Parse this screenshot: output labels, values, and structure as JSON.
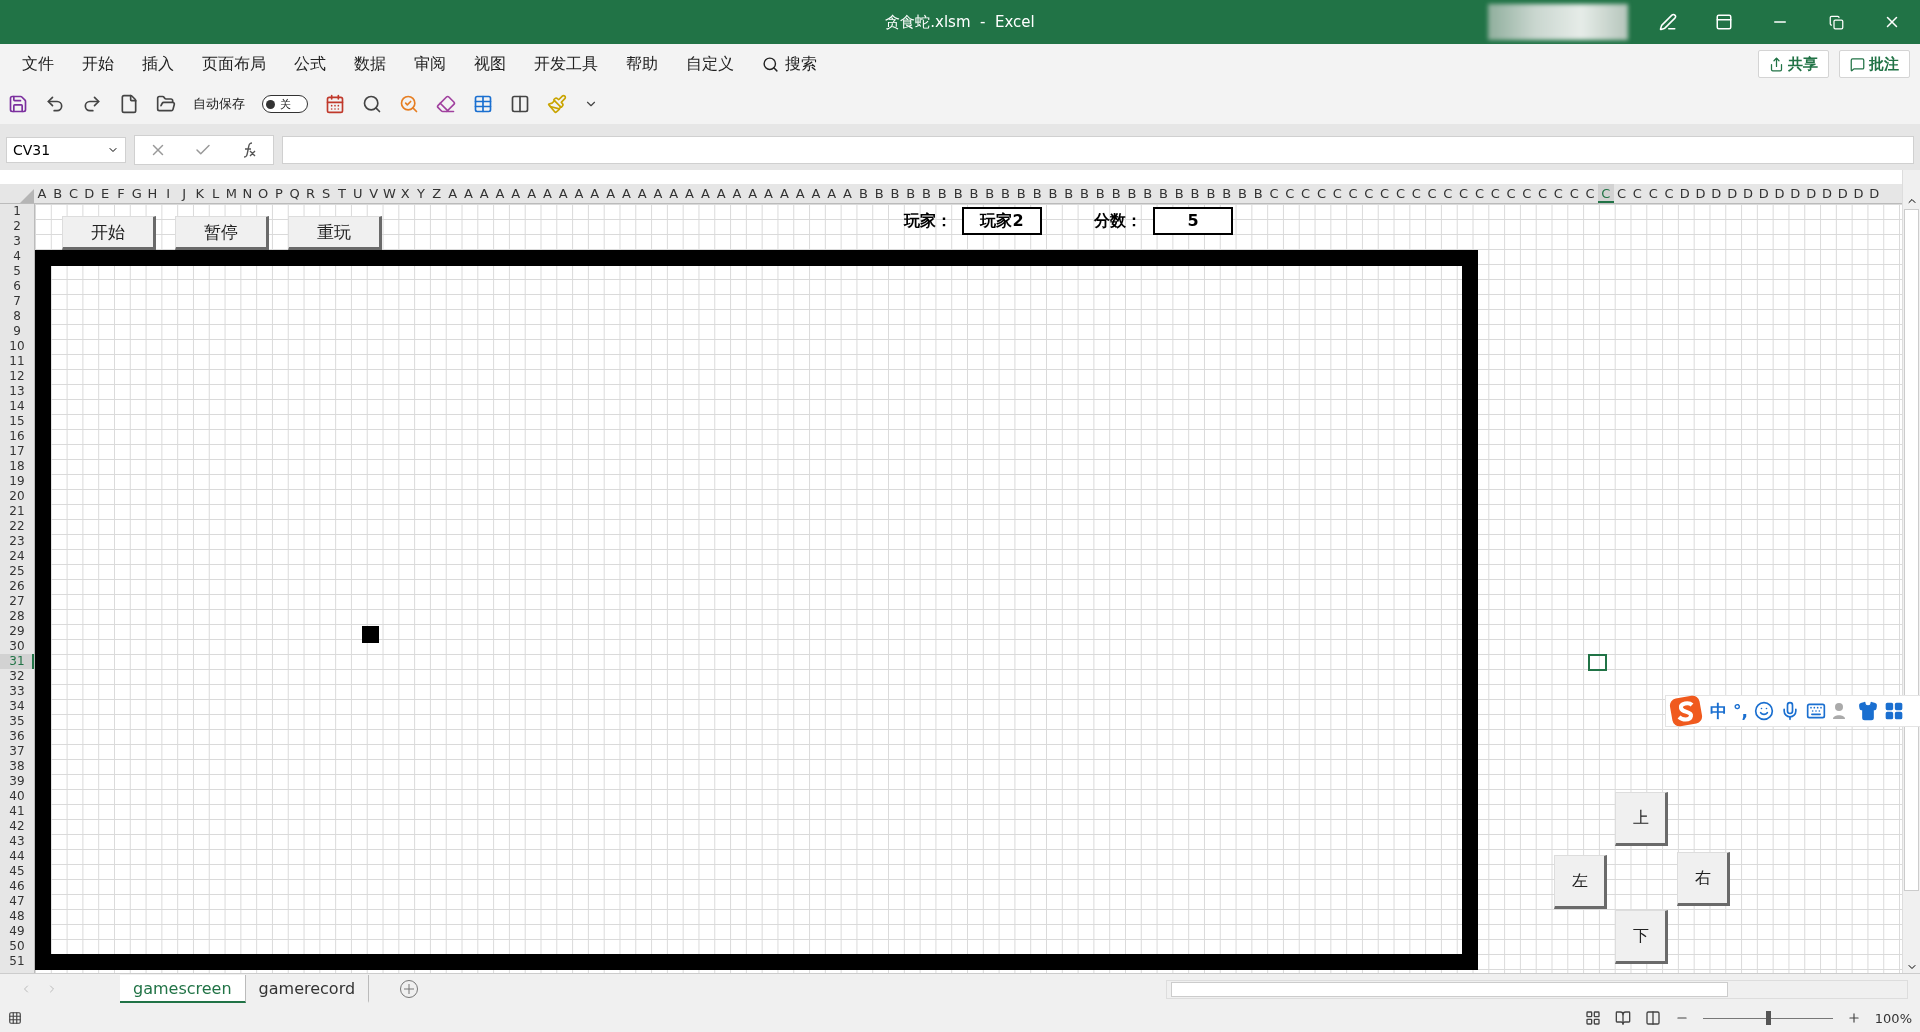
{
  "window": {
    "title": "贪食蛇.xlsm  -  Excel"
  },
  "menu": [
    "文件",
    "开始",
    "插入",
    "页面布局",
    "公式",
    "数据",
    "审阅",
    "视图",
    "开发工具",
    "帮助",
    "自定义"
  ],
  "menu_search": {
    "label": "搜索"
  },
  "header_buttons": [
    {
      "kind": "share",
      "label": "共享"
    },
    {
      "kind": "comment",
      "label": "批注"
    }
  ],
  "quick_access": {
    "autosave_label": "自动保存",
    "autosave": {
      "on": false,
      "label": "关"
    }
  },
  "formula_bar": {
    "name_box": "CV31"
  },
  "column_headers": [
    {
      "label": "A",
      "selected": false
    },
    {
      "label": "B",
      "selected": false
    },
    {
      "label": "C",
      "selected": false
    },
    {
      "label": "D",
      "selected": false
    },
    {
      "label": "E",
      "selected": false
    },
    {
      "label": "F",
      "selected": false
    },
    {
      "label": "G",
      "selected": false
    },
    {
      "label": "H",
      "selected": false
    },
    {
      "label": "I",
      "selected": false
    },
    {
      "label": "J",
      "selected": false
    },
    {
      "label": "K",
      "selected": false
    },
    {
      "label": "L",
      "selected": false
    },
    {
      "label": "M",
      "selected": false
    },
    {
      "label": "N",
      "selected": false
    },
    {
      "label": "O",
      "selected": false
    },
    {
      "label": "P",
      "selected": false
    },
    {
      "label": "Q",
      "selected": false
    },
    {
      "label": "R",
      "selected": false
    },
    {
      "label": "S",
      "selected": false
    },
    {
      "label": "T",
      "selected": false
    },
    {
      "label": "U",
      "selected": false
    },
    {
      "label": "V",
      "selected": false
    },
    {
      "label": "W",
      "selected": false
    },
    {
      "label": "X",
      "selected": false
    },
    {
      "label": "Y",
      "selected": false
    },
    {
      "label": "Z",
      "selected": false
    },
    {
      "label": "A",
      "selected": false
    },
    {
      "label": "A",
      "selected": false
    },
    {
      "label": "A",
      "selected": false
    },
    {
      "label": "A",
      "selected": false
    },
    {
      "label": "A",
      "selected": false
    },
    {
      "label": "A",
      "selected": false
    },
    {
      "label": "A",
      "selected": false
    },
    {
      "label": "A",
      "selected": false
    },
    {
      "label": "A",
      "selected": false
    },
    {
      "label": "A",
      "selected": false
    },
    {
      "label": "A",
      "selected": false
    },
    {
      "label": "A",
      "selected": false
    },
    {
      "label": "A",
      "selected": false
    },
    {
      "label": "A",
      "selected": false
    },
    {
      "label": "A",
      "selected": false
    },
    {
      "label": "A",
      "selected": false
    },
    {
      "label": "A",
      "selected": false
    },
    {
      "label": "A",
      "selected": false
    },
    {
      "label": "A",
      "selected": false
    },
    {
      "label": "A",
      "selected": false
    },
    {
      "label": "A",
      "selected": false
    },
    {
      "label": "A",
      "selected": false
    },
    {
      "label": "A",
      "selected": false
    },
    {
      "label": "A",
      "selected": false
    },
    {
      "label": "A",
      "selected": false
    },
    {
      "label": "A",
      "selected": false
    },
    {
      "label": "B",
      "selected": false
    },
    {
      "label": "B",
      "selected": false
    },
    {
      "label": "B",
      "selected": false
    },
    {
      "label": "B",
      "selected": false
    },
    {
      "label": "B",
      "selected": false
    },
    {
      "label": "B",
      "selected": false
    },
    {
      "label": "B",
      "selected": false
    },
    {
      "label": "B",
      "selected": false
    },
    {
      "label": "B",
      "selected": false
    },
    {
      "label": "B",
      "selected": false
    },
    {
      "label": "B",
      "selected": false
    },
    {
      "label": "B",
      "selected": false
    },
    {
      "label": "B",
      "selected": false
    },
    {
      "label": "B",
      "selected": false
    },
    {
      "label": "B",
      "selected": false
    },
    {
      "label": "B",
      "selected": false
    },
    {
      "label": "B",
      "selected": false
    },
    {
      "label": "B",
      "selected": false
    },
    {
      "label": "B",
      "selected": false
    },
    {
      "label": "B",
      "selected": false
    },
    {
      "label": "B",
      "selected": false
    },
    {
      "label": "B",
      "selected": false
    },
    {
      "label": "B",
      "selected": false
    },
    {
      "label": "B",
      "selected": false
    },
    {
      "label": "B",
      "selected": false
    },
    {
      "label": "B",
      "selected": false
    },
    {
      "label": "C",
      "selected": false
    },
    {
      "label": "C",
      "selected": false
    },
    {
      "label": "C",
      "selected": false
    },
    {
      "label": "C",
      "selected": false
    },
    {
      "label": "C",
      "selected": false
    },
    {
      "label": "C",
      "selected": false
    },
    {
      "label": "C",
      "selected": false
    },
    {
      "label": "C",
      "selected": false
    },
    {
      "label": "C",
      "selected": false
    },
    {
      "label": "C",
      "selected": false
    },
    {
      "label": "C",
      "selected": false
    },
    {
      "label": "C",
      "selected": false
    },
    {
      "label": "C",
      "selected": false
    },
    {
      "label": "C",
      "selected": false
    },
    {
      "label": "C",
      "selected": false
    },
    {
      "label": "C",
      "selected": false
    },
    {
      "label": "C",
      "selected": false
    },
    {
      "label": "C",
      "selected": false
    },
    {
      "label": "C",
      "selected": false
    },
    {
      "label": "C",
      "selected": false
    },
    {
      "label": "C",
      "selected": false
    },
    {
      "label": "C",
      "selected": true
    },
    {
      "label": "C",
      "selected": false
    },
    {
      "label": "C",
      "selected": false
    },
    {
      "label": "C",
      "selected": false
    },
    {
      "label": "C",
      "selected": false
    },
    {
      "label": "D",
      "selected": false
    },
    {
      "label": "D",
      "selected": false
    },
    {
      "label": "D",
      "selected": false
    },
    {
      "label": "D",
      "selected": false
    },
    {
      "label": "D",
      "selected": false
    },
    {
      "label": "D",
      "selected": false
    },
    {
      "label": "D",
      "selected": false
    },
    {
      "label": "D",
      "selected": false
    },
    {
      "label": "D",
      "selected": false
    },
    {
      "label": "D",
      "selected": false
    },
    {
      "label": "D",
      "selected": false
    },
    {
      "label": "D",
      "selected": false
    },
    {
      "label": "D",
      "selected": false
    }
  ],
  "row_headers": [
    {
      "label": "1",
      "selected": false
    },
    {
      "label": "2",
      "selected": false
    },
    {
      "label": "3",
      "selected": false
    },
    {
      "label": "4",
      "selected": false
    },
    {
      "label": "5",
      "selected": false
    },
    {
      "label": "6",
      "selected": false
    },
    {
      "label": "7",
      "selected": false
    },
    {
      "label": "8",
      "selected": false
    },
    {
      "label": "9",
      "selected": false
    },
    {
      "label": "10",
      "selected": false
    },
    {
      "label": "11",
      "selected": false
    },
    {
      "label": "12",
      "selected": false
    },
    {
      "label": "13",
      "selected": false
    },
    {
      "label": "14",
      "selected": false
    },
    {
      "label": "15",
      "selected": false
    },
    {
      "label": "16",
      "selected": false
    },
    {
      "label": "17",
      "selected": false
    },
    {
      "label": "18",
      "selected": false
    },
    {
      "label": "19",
      "selected": false
    },
    {
      "label": "20",
      "selected": false
    },
    {
      "label": "21",
      "selected": false
    },
    {
      "label": "22",
      "selected": false
    },
    {
      "label": "23",
      "selected": false
    },
    {
      "label": "24",
      "selected": false
    },
    {
      "label": "25",
      "selected": false
    },
    {
      "label": "26",
      "selected": false
    },
    {
      "label": "27",
      "selected": false
    },
    {
      "label": "28",
      "selected": false
    },
    {
      "label": "29",
      "selected": false
    },
    {
      "label": "30",
      "selected": false
    },
    {
      "label": "31",
      "selected": true
    },
    {
      "label": "32",
      "selected": false
    },
    {
      "label": "33",
      "selected": false
    },
    {
      "label": "34",
      "selected": false
    },
    {
      "label": "35",
      "selected": false
    },
    {
      "label": "36",
      "selected": false
    },
    {
      "label": "37",
      "selected": false
    },
    {
      "label": "38",
      "selected": false
    },
    {
      "label": "39",
      "selected": false
    },
    {
      "label": "40",
      "selected": false
    },
    {
      "label": "41",
      "selected": false
    },
    {
      "label": "42",
      "selected": false
    },
    {
      "label": "43",
      "selected": false
    },
    {
      "label": "44",
      "selected": false
    },
    {
      "label": "45",
      "selected": false
    },
    {
      "label": "46",
      "selected": false
    },
    {
      "label": "47",
      "selected": false
    },
    {
      "label": "48",
      "selected": false
    },
    {
      "label": "49",
      "selected": false
    },
    {
      "label": "50",
      "selected": false
    },
    {
      "label": "51",
      "selected": false
    }
  ],
  "sheet": {
    "buttons": [
      "开始",
      "暂停",
      "重玩"
    ],
    "player_label": "玩家：",
    "player": "玩家2",
    "score_label": "分数：",
    "score": "5",
    "direction_buttons": [
      {
        "kind": "up",
        "label": "上"
      },
      {
        "kind": "left",
        "label": "左"
      },
      {
        "kind": "right",
        "label": "右"
      },
      {
        "kind": "down",
        "label": "下"
      }
    ]
  },
  "ime": {
    "mode": "中",
    "punctuation": "°,"
  },
  "sheet_tabs": [
    {
      "label": "gamescreen",
      "selected": true
    },
    {
      "label": "gamerecord",
      "selected": false
    }
  ],
  "status_bar": {
    "zoom": "100%",
    "zoom_slider": {
      "level": 0.5
    }
  }
}
